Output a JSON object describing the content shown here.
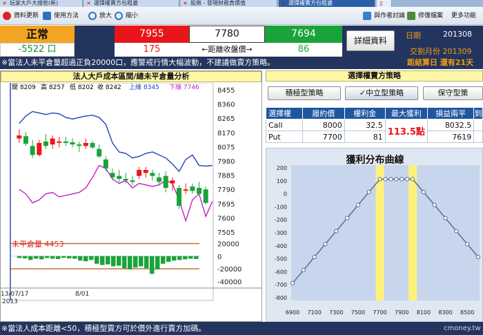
{
  "tabs": [
    {
      "label": "玩家大戶大搜密(新)",
      "active": false
    },
    {
      "label": "選擇權賣方包租婆",
      "active": false
    },
    {
      "label": "股無 - 發現財務真價值",
      "active": false
    },
    {
      "label": "選擇權賣方包租婆",
      "active": true
    }
  ],
  "toolbar": {
    "left": [
      {
        "label": "資料更新",
        "icon": "refresh-icon"
      },
      {
        "label": "使用方法",
        "icon": "help-icon"
      },
      {
        "label": "放大",
        "icon": "zoom-in-icon"
      },
      {
        "label": "縮小",
        "icon": "zoom-out-icon"
      }
    ],
    "right": [
      {
        "label": "與作者討論",
        "icon": "chat-icon"
      },
      {
        "label": "修復檔案",
        "icon": "repair-icon"
      },
      {
        "label": "更多功能",
        "icon": "more-icon"
      }
    ]
  },
  "status": {
    "label": "正常",
    "net": "-5522 口"
  },
  "prices": {
    "upper": "7955",
    "upper_diff": "175",
    "close": "7780",
    "close_label": "←距離收盤價→",
    "lower": "7694",
    "lower_diff": "86"
  },
  "detail_button": "詳細資料",
  "info": {
    "date_label": "日期",
    "date_value": "201308",
    "month_label": "交割月份",
    "month_value": "201309",
    "days_label": "距結算日 還有21天"
  },
  "warning": "※當法人未平倉量超過正負20000口，應警戒行情大幅波動，不建議做賣方策略。",
  "left_title": "法人大戶成本區間/總未平倉量分析",
  "candle_chart": {
    "legend": {
      "open": "開 8209",
      "high": "高 8257",
      "low": "低 8202",
      "close": "收 8242",
      "upper": "上緣 8345",
      "lower": "下緣 7746"
    },
    "y_ticks": [
      "8455",
      "8360",
      "8265",
      "8170",
      "8075",
      "7980",
      "7885",
      "7790",
      "7695",
      "7600",
      "7505"
    ],
    "ylim": [
      7505,
      8455
    ],
    "candles": [
      {
        "o": 8130,
        "h": 8190,
        "l": 8100,
        "c": 8150
      },
      {
        "o": 8145,
        "h": 8175,
        "l": 8080,
        "c": 8095
      },
      {
        "o": 8080,
        "h": 8120,
        "l": 8000,
        "c": 8020
      },
      {
        "o": 8020,
        "h": 8120,
        "l": 8010,
        "c": 8100
      },
      {
        "o": 8110,
        "h": 8160,
        "l": 8060,
        "c": 8080
      },
      {
        "o": 8090,
        "h": 8150,
        "l": 8060,
        "c": 8130
      },
      {
        "o": 8110,
        "h": 8140,
        "l": 8070,
        "c": 8110
      },
      {
        "o": 8110,
        "h": 8140,
        "l": 8080,
        "c": 8100
      },
      {
        "o": 8105,
        "h": 8130,
        "l": 8070,
        "c": 8090
      },
      {
        "o": 8090,
        "h": 8110,
        "l": 8040,
        "c": 8080
      },
      {
        "o": 8080,
        "h": 8130,
        "l": 8060,
        "c": 8100
      },
      {
        "o": 8100,
        "h": 8115,
        "l": 8060,
        "c": 8070
      },
      {
        "o": 8060,
        "h": 8090,
        "l": 8000,
        "c": 8010
      },
      {
        "o": 7990,
        "h": 8010,
        "l": 7910,
        "c": 7930
      },
      {
        "o": 7900,
        "h": 7930,
        "l": 7850,
        "c": 7870
      },
      {
        "o": 7880,
        "h": 7920,
        "l": 7840,
        "c": 7860
      },
      {
        "o": 7860,
        "h": 7900,
        "l": 7830,
        "c": 7850
      },
      {
        "o": 7850,
        "h": 7880,
        "l": 7820,
        "c": 7840
      },
      {
        "o": 7880,
        "h": 7940,
        "l": 7860,
        "c": 7920
      },
      {
        "o": 7900,
        "h": 7940,
        "l": 7870,
        "c": 7920
      },
      {
        "o": 7900,
        "h": 7920,
        "l": 7850,
        "c": 7880
      },
      {
        "o": 7870,
        "h": 7900,
        "l": 7820,
        "c": 7840
      },
      {
        "o": 7880,
        "h": 7910,
        "l": 7770,
        "c": 7800
      },
      {
        "o": 7830,
        "h": 7870,
        "l": 7780,
        "c": 7850
      },
      {
        "o": 7800,
        "h": 7820,
        "l": 7660,
        "c": 7680
      },
      {
        "o": 7790,
        "h": 7830,
        "l": 7760,
        "c": 7790
      },
      {
        "o": 7810,
        "h": 7830,
        "l": 7760,
        "c": 7780
      },
      {
        "o": 7800,
        "h": 7840,
        "l": 7760,
        "c": 7760
      },
      {
        "o": 7790,
        "h": 7810,
        "l": 7690,
        "c": 7700
      }
    ],
    "upper_line": [
      8230,
      8280,
      8310,
      8300,
      8290,
      8300,
      8295,
      8270,
      8260,
      8270,
      8280,
      8285,
      8270,
      8225,
      8100,
      8040,
      8030,
      8000,
      8010,
      8030,
      8040,
      8020,
      8000,
      7960,
      7910,
      7990,
      8020,
      7950,
      7945,
      7950
    ],
    "lower_line": [
      7790,
      7760,
      7700,
      7720,
      7760,
      7770,
      7740,
      7750,
      7760,
      7770,
      7800,
      7870,
      7950,
      7930,
      7860,
      7830,
      7850,
      7800,
      7830,
      7820,
      7810,
      7820,
      7850,
      7830,
      7720,
      7580,
      7720,
      7760,
      7610,
      7710
    ]
  },
  "oi_chart": {
    "title": "未平倉量 4453",
    "y_ticks": [
      "20000",
      "0",
      "-20000",
      "-40000"
    ],
    "ylim": [
      -45000,
      25000
    ],
    "values": [
      -3000,
      -3500,
      -6000,
      -4000,
      -5000,
      -3000,
      -4000,
      -4500,
      -2500,
      -3500,
      -4000,
      -7000,
      -8000,
      -6000,
      -12000,
      -14000,
      -13000,
      -16000,
      -15000,
      -19000,
      -21000,
      -18000,
      -16000,
      -19000,
      -28000,
      -21000,
      -12000,
      -9000,
      -7000,
      -6000,
      -5000,
      -4000,
      -4453
    ]
  },
  "x_labels": [
    "13/07/17",
    "8/01"
  ],
  "year_label": "2013",
  "footer_note": "※當法人成本距離<50，積極型賣方可於價外進行賣方加碼。",
  "right_title": "選擇權賣方策略",
  "strategy_buttons": [
    "積極型策略",
    "✓中立型策略",
    "保守型策"
  ],
  "table": {
    "headers": [
      "選擇權",
      "履約價",
      "權利金",
      "最大獲利",
      "損益兩平",
      "到"
    ],
    "rows": [
      {
        "type": "Call",
        "strike": "8000",
        "premium": "32.5",
        "breakeven": "8032.5"
      },
      {
        "type": "Put",
        "strike": "7700",
        "premium": "81",
        "breakeven": "7619"
      }
    ],
    "max_profit": "113.5點"
  },
  "chart_data": {
    "type": "line",
    "title": "獲利分布曲線",
    "x": [
      6900,
      7000,
      7100,
      7200,
      7300,
      7400,
      7500,
      7600,
      7700,
      7750,
      7800,
      7850,
      7900,
      7950,
      8000,
      8100,
      8200,
      8300,
      8400,
      8500,
      8600
    ],
    "y": [
      -688,
      -588,
      -487,
      -387,
      -287,
      -187,
      -86,
      14,
      113,
      113,
      113,
      113,
      113,
      113,
      113,
      14,
      -86,
      -187,
      -287,
      -387,
      -487
    ],
    "x_ticks": [
      "6900",
      "7100",
      "7300",
      "7500",
      "7700",
      "7900",
      "8100",
      "8300",
      "8500"
    ],
    "y_ticks": [
      "200",
      "100",
      "0",
      "-100",
      "-200",
      "-300",
      "-400",
      "-500",
      "-600",
      "-700",
      "-800"
    ],
    "ylim": [
      -800,
      200
    ],
    "xlim": [
      6900,
      8600
    ],
    "highlight_strikes": [
      7700,
      8000
    ]
  },
  "watermark": "cmoney.tw",
  "colors": {
    "red": "#e8161b",
    "green": "#1aa33a",
    "navy": "#23345e",
    "orange": "#f39c12",
    "yellow": "#fdf7a6",
    "blue": "#1e56a0"
  }
}
